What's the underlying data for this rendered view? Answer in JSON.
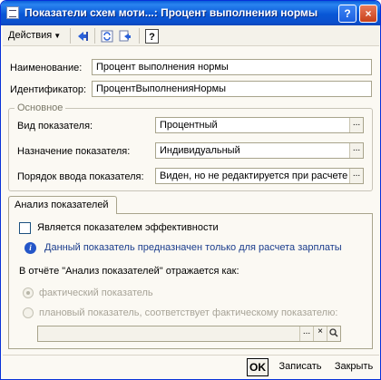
{
  "window": {
    "title": "Показатели схем моти...: Процент выполнения нормы",
    "help_button": "?",
    "close_button": "×"
  },
  "toolbar": {
    "actions_label": "Действия",
    "help_label": "?"
  },
  "form": {
    "name_label": "Наименование:",
    "name_value": "Процент выполнения нормы",
    "id_label": "Идентификатор:",
    "id_value": "ПроцентВыполненияНормы",
    "group_title": "Основное",
    "kind_label": "Вид показателя:",
    "kind_value": "Процентный",
    "purpose_label": "Назначение показателя:",
    "purpose_value": "Индивидуальный",
    "input_order_label": "Порядок ввода показателя:",
    "input_order_value": "Виден, но не редактируется при расчете",
    "select_button": "..."
  },
  "analysis": {
    "tab_label": "Анализ показателей",
    "efficiency_checkbox_label": "Является показателем эффективности",
    "efficiency_checked": false,
    "info_text": "Данный показатель предназначен только для расчета зарплаты",
    "report_label": "В отчёте \"Анализ показателей\" отражается как:",
    "radio_actual": "фактический показатель",
    "radio_planned": "плановый показатель, соответствует фактическому показателю:",
    "selected_radio": "фактический показатель",
    "planned_field_value": "",
    "field_buttons": [
      "...",
      "×",
      "search-icon"
    ]
  },
  "buttons": {
    "ok": "OK",
    "save": "Записать",
    "close": "Закрыть"
  },
  "colors": {
    "titlebar": "#0857d6",
    "window_bg": "#fbf9f3",
    "info_text": "#1a3c8c",
    "disabled_text": "#a8a498"
  }
}
